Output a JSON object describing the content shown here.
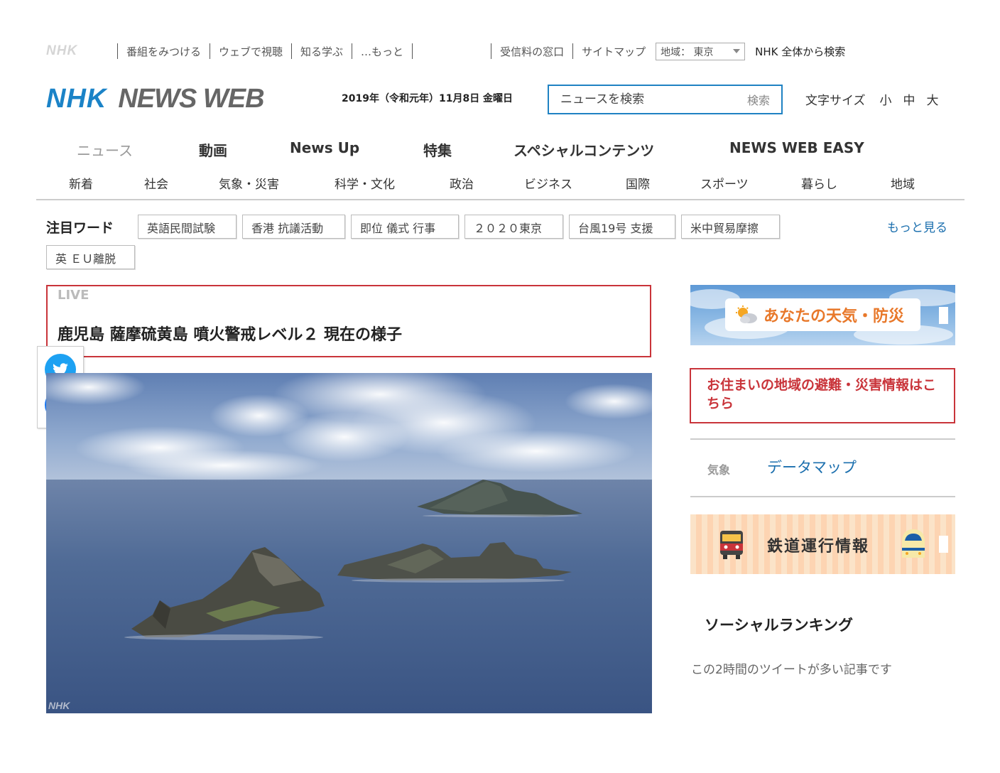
{
  "topbar": {
    "logo": "NHK",
    "links": [
      "番組をみつける",
      "ウェブで視聴",
      "知る学ぶ",
      "…もっと"
    ],
    "links_right": [
      "受信料の窓口",
      "サイトマップ"
    ],
    "region_label": "地域： 東京",
    "global_search": "NHK 全体から検索"
  },
  "header": {
    "brand_nhk": "NHK",
    "brand_newsweb": "NEWS WEB",
    "date": "2019年（令和元年）11月8日 金曜日",
    "search_placeholder": "ニュースを検索",
    "search_button": "検索",
    "fontsize_label": "文字サイズ",
    "fontsize_options": [
      "小",
      "中",
      "大"
    ]
  },
  "main_nav": [
    "ニュース",
    "動画",
    "News Up",
    "特集",
    "スペシャルコンテンツ",
    "NEWS WEB EASY"
  ],
  "sub_nav": [
    "新着",
    "社会",
    "気象・災害",
    "科学・文化",
    "政治",
    "ビジネス",
    "国際",
    "スポーツ",
    "暮らし",
    "地域"
  ],
  "hot_words": {
    "label": "注目ワード",
    "tags": [
      "英語民間試験",
      "香港 抗議活動",
      "即位 儀式 行事",
      "２０２０東京",
      "台風19号 支援",
      "米中貿易摩擦",
      "英 ＥＵ離脱"
    ],
    "more": "もっと見る"
  },
  "live": {
    "tag": "LIVE",
    "title": "鹿児島 薩摩硫黄島 噴火警戒レベル２ 現在の様子"
  },
  "photo": {
    "watermark": "NHK"
  },
  "sidebar": {
    "weather_banner": "あなたの天気・防災",
    "evacuation": "お住まいの地域の避難・災害情報はこちら",
    "kisho_label": "気象",
    "datamap_link": "データマップ",
    "train_banner": "鉄道運行情報",
    "ranking_title": "ソーシャルランキング",
    "ranking_sub": "この2時間のツイートが多い記事です"
  },
  "colors": {
    "nhk_blue": "#1b83c7",
    "alert_red": "#c9343a",
    "link_blue": "#1b6fae",
    "twitter": "#1da1f2",
    "facebook": "#1877f2"
  }
}
